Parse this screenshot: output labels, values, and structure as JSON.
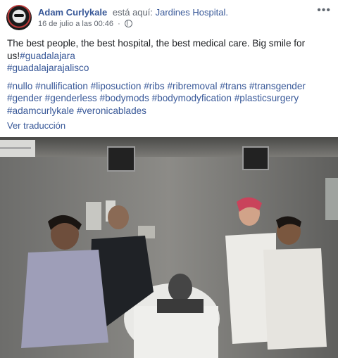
{
  "post": {
    "author": "Adam Curlykale",
    "action": "está aquí:",
    "place": "Jardines Hospital.",
    "timestamp": "16 de julio a las 00:46",
    "separator": "·",
    "privacy_icon": "globe-icon",
    "more_icon": "more-options-icon",
    "text": "The best people, the best hospital, the best medical care. Big smile for us!",
    "inline_tag": "#guadalajara",
    "line2_tags": [
      "#guadalajarajalisco"
    ],
    "hashtags": [
      "#nullo",
      "#nullification",
      "#liposuction",
      "#ribs",
      "#ribremoval",
      "#trans",
      "#transgender",
      "#gender",
      "#genderless",
      "#bodymods",
      "#bodymodyfication",
      "#plasticsurgery",
      "#adamcurlykale",
      "#veronicablades"
    ],
    "translate_link": "Ver traducción"
  },
  "colors": {
    "link": "#385898",
    "text": "#1c1e21",
    "meta": "#616770"
  }
}
